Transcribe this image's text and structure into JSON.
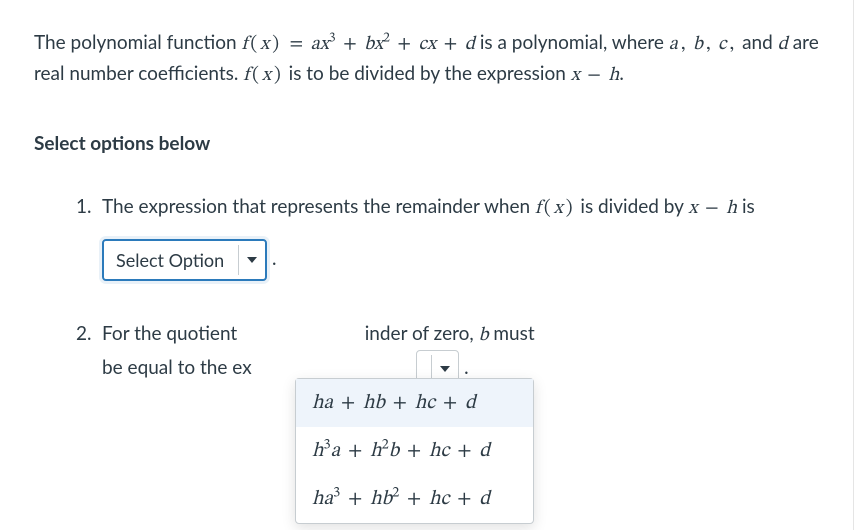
{
  "intro": {
    "pre1": "The polynomial function ",
    "func": "f(x) = ax³ + bx² + cx + d",
    "post1": " is a polynomial, where ",
    "coeffs": "a, b, c,",
    "and": " and ",
    "dvar": "d",
    "post2": " are real number coefficients. ",
    "fx": "f(x)",
    "post3": " is to be divided by the expression ",
    "xmh": "x − h",
    "period": "."
  },
  "prompt": "Select options below",
  "q1": {
    "pre": "The expression that represents the remainder when ",
    "fx": "f(x)",
    "mid": " is divided by ",
    "xmh": "x − h",
    "is": " is ",
    "placeholder": "Select Option",
    "period": "."
  },
  "q2": {
    "pre": "For the quotient ",
    "hidden_mid": "to have a remainder of zero, ",
    "visible_mid": "inder of zero, ",
    "bvar": "b",
    "post": " must be equal to the ex",
    "period": "."
  },
  "dropdown": {
    "options": [
      "ha + hb + hc + d",
      "h³a + h²b + hc + d",
      "ha³ + hb² + hc + d"
    ],
    "highlighted_index": 0
  }
}
